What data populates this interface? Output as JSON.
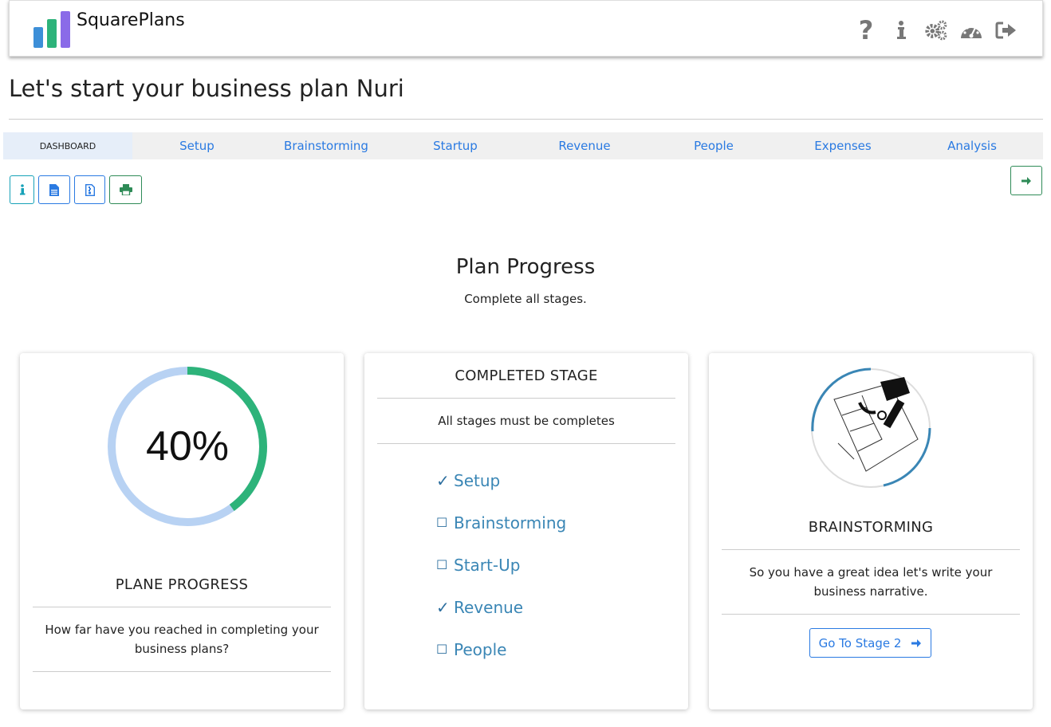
{
  "app": {
    "brand": "SquarePlans"
  },
  "header_icons": [
    "help-icon",
    "info-icon",
    "settings-icon",
    "dashboard-icon",
    "logout-icon"
  ],
  "greeting": "Let's start your business plan Nuri",
  "tabs": [
    {
      "label": "DASHBOARD",
      "active": true
    },
    {
      "label": "Setup"
    },
    {
      "label": "Brainstorming"
    },
    {
      "label": "Startup"
    },
    {
      "label": "Revenue"
    },
    {
      "label": "People"
    },
    {
      "label": "Expenses"
    },
    {
      "label": "Analysis"
    }
  ],
  "toolbar": {
    "buttons": [
      "info-icon",
      "document-icon",
      "pdf-icon",
      "print-icon"
    ],
    "next": "arrow-right-icon"
  },
  "section": {
    "title": "Plan Progress",
    "subtitle": "Complete all stages."
  },
  "progress_card": {
    "value_label": "40%",
    "progress": 0.4,
    "title": "PLANE PROGRESS",
    "text": "How far have you reached in completing your business plans?"
  },
  "stages_card": {
    "title": "COMPLETED STAGE",
    "text": "All stages must be completes",
    "stages": [
      {
        "label": "Setup",
        "done": true
      },
      {
        "label": "Brainstorming",
        "done": false
      },
      {
        "label": "Start-Up",
        "done": false
      },
      {
        "label": "Revenue",
        "done": true
      },
      {
        "label": "People",
        "done": false
      }
    ],
    "check_mark": "✓",
    "box_mark": "☐"
  },
  "next_card": {
    "title": "BRAINSTORMING",
    "text": "So you have a great idea let's write your business narrative.",
    "button_label": "Go To Stage 2"
  },
  "colors": {
    "accent": "#2a7ae2",
    "progress_fill": "#2db37a",
    "progress_track": "#b8d2f3",
    "stage_text": "#3a86b5",
    "green": "#2e8b57",
    "teal": "#17a2b8"
  }
}
